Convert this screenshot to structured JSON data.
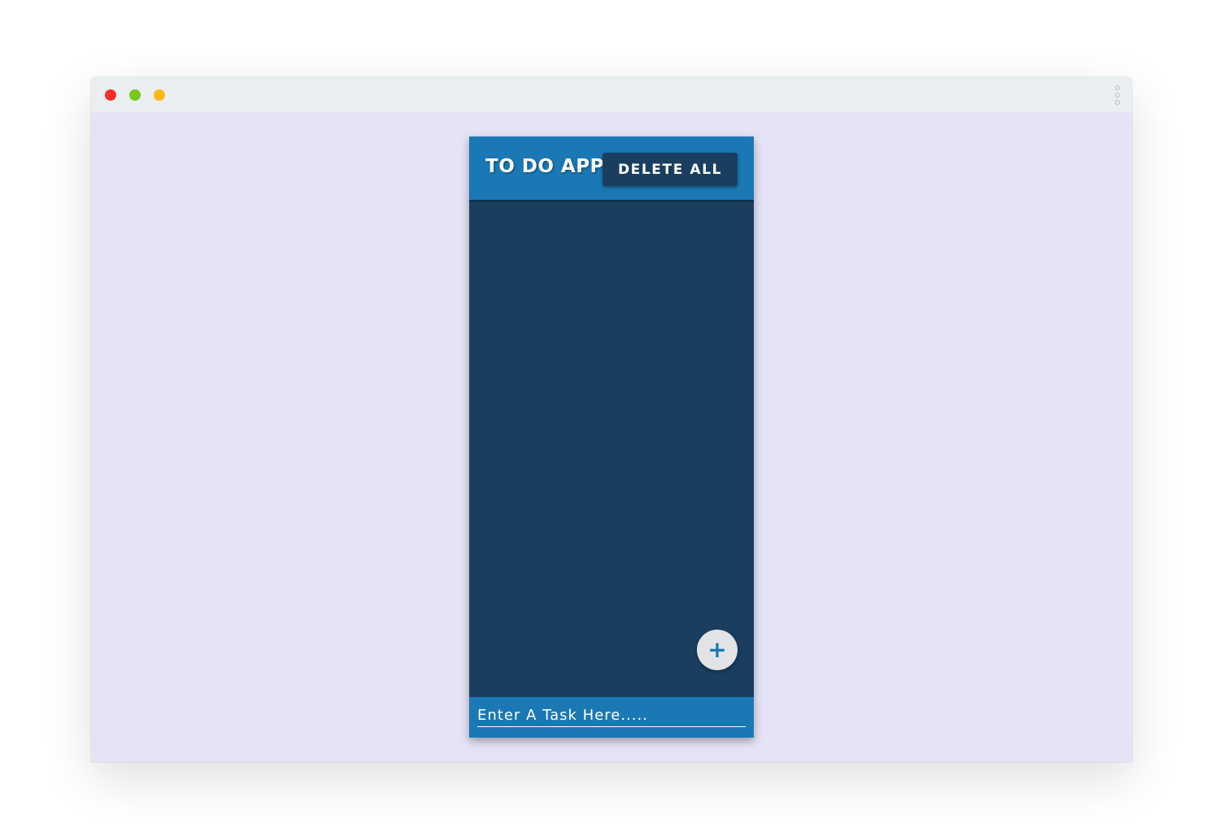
{
  "window": {
    "controls": [
      "close-icon",
      "minimize-icon",
      "maximize-icon"
    ],
    "menu_icon": "kebab-menu-icon"
  },
  "app": {
    "title": "TO DO APP",
    "delete_all_label": "DELETE ALL",
    "tasks": [],
    "add_button_icon": "+",
    "task_input": {
      "placeholder": "Enter A Task Here.....",
      "value": ""
    }
  },
  "colors": {
    "page_background": "#e5e4f6",
    "header": "#1a78b4",
    "list_background": "#193e60",
    "delete_button": "#193e60",
    "add_button": "#e2e3e6",
    "close": "#fe2c2c",
    "minimize": "#78c719",
    "maximize": "#fdb912"
  }
}
